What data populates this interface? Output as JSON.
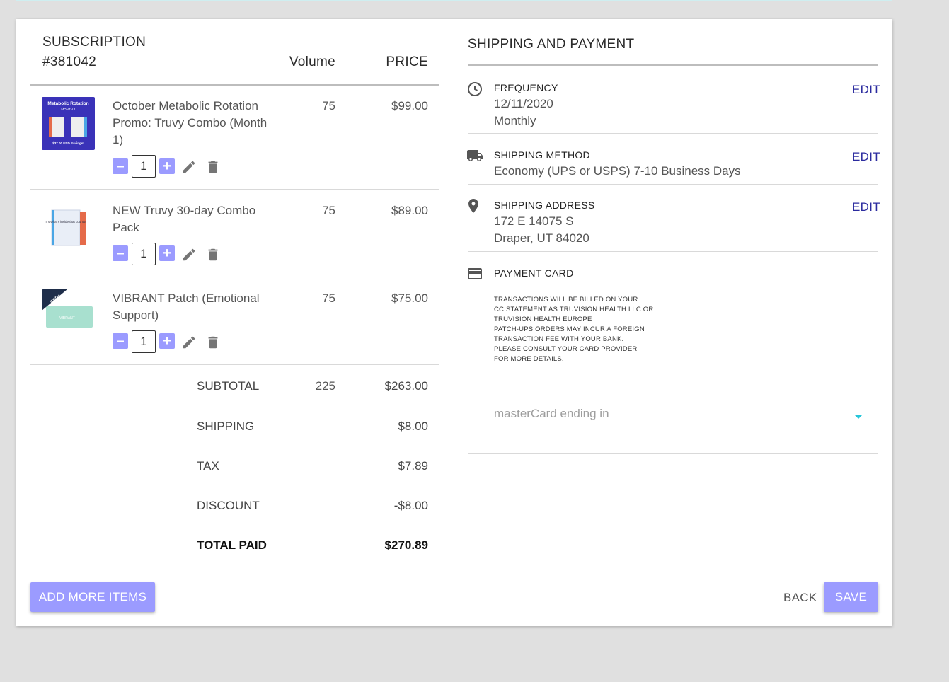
{
  "order": {
    "title_line1": "SUBSCRIPTION",
    "title_line2": "#381042",
    "col_volume": "Volume",
    "col_price": "PRICE",
    "items": [
      {
        "name": "October Metabolic Rotation Promo: Truvy Combo (Month 1)",
        "volume": "75",
        "price": "$99.00",
        "quantity": "1",
        "thumb_title": "Metabolic Rotation",
        "thumb_sub": "MONTH 1",
        "thumb_badge": "$37.00 USD Savings!"
      },
      {
        "name": "NEW Truvy 30-day Combo Pack",
        "volume": "75",
        "price": "$89.00",
        "quantity": "1",
        "thumb_text": "It's what's inside that counts!"
      },
      {
        "name": "VIBRANT Patch (Emotional Support)",
        "volume": "75",
        "price": "$75.00",
        "quantity": "1",
        "thumb_ribbon": "CBD+",
        "thumb_text": "VIBRANT"
      }
    ],
    "subtotal": {
      "label": "SUBTOTAL",
      "volume": "225",
      "value": "$263.00"
    },
    "shipping": {
      "label": "SHIPPING",
      "value": "$8.00"
    },
    "tax": {
      "label": "TAX",
      "value": "$7.89"
    },
    "discount": {
      "label": "DISCOUNT",
      "value": "-$8.00"
    },
    "total": {
      "label": "TOTAL PAID",
      "value": "$270.89"
    }
  },
  "shipping_payment": {
    "title": "SHIPPING AND PAYMENT",
    "frequency": {
      "label": "FREQUENCY",
      "date": "12/11/2020",
      "period": "Monthly",
      "edit": "EDIT"
    },
    "method": {
      "label": "SHIPPING METHOD",
      "value": "Economy (UPS or USPS) 7-10 Business Days",
      "edit": "EDIT"
    },
    "address": {
      "label": "SHIPPING ADDRESS",
      "line1": "172 E 14075 S",
      "line2": "Draper, UT 84020",
      "edit": "EDIT"
    },
    "payment": {
      "label": "PAYMENT CARD",
      "notice": [
        "TRANSACTIONS WILL BE BILLED ON YOUR",
        "CC STATEMENT AS TRUVISION HEALTH LLC OR",
        "TRUVISION HEALTH EUROPE",
        "PATCH-UPS ORDERS MAY INCUR A FOREIGN",
        "TRANSACTION FEE WITH YOUR BANK.",
        "PLEASE CONSULT YOUR CARD PROVIDER",
        "FOR MORE DETAILS."
      ],
      "card_select": "masterCard ending in"
    }
  },
  "actions": {
    "add_more": "ADD MORE ITEMS",
    "back": "BACK",
    "save": "SAVE"
  },
  "colors": {
    "accent": "#9b9bff",
    "edit_link": "#2b2b9f",
    "dropdown_caret": "#26c6da"
  },
  "icons": [
    "minus-icon",
    "plus-icon",
    "pencil-icon",
    "trash-icon",
    "clock-icon",
    "truck-icon",
    "map-pin-icon",
    "credit-card-icon",
    "chevron-down-icon"
  ]
}
